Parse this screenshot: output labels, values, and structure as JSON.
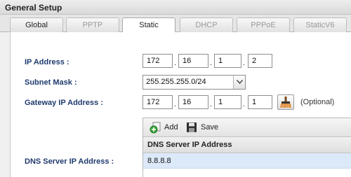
{
  "panel": {
    "title": "General Setup"
  },
  "tabs": [
    {
      "label": "Global",
      "state": "enabled"
    },
    {
      "label": "PPTP",
      "state": "disabled"
    },
    {
      "label": "Static",
      "state": "active"
    },
    {
      "label": "DHCP",
      "state": "disabled"
    },
    {
      "label": "PPPoE",
      "state": "disabled"
    },
    {
      "label": "StaticV6",
      "state": "disabled"
    }
  ],
  "form": {
    "ip_address": {
      "label": "IP Address :",
      "octets": [
        "172",
        "16",
        "1",
        "2"
      ]
    },
    "subnet_mask": {
      "label": "Subnet Mask :",
      "value": "255.255.255.0/24"
    },
    "gateway": {
      "label": "Gateway IP Address :",
      "octets": [
        "172",
        "16",
        "1",
        "1"
      ],
      "optional_text": "(Optional)"
    },
    "dns": {
      "label": "DNS Server IP Address :",
      "add_label": "Add",
      "save_label": "Save",
      "column_header": "DNS Server IP Address",
      "rows": [
        "8.8.8.8"
      ]
    }
  },
  "icons": {
    "add": "add-circle-icon",
    "save": "floppy-disk-icon",
    "selector": "broom-icon",
    "dropdown": "chevron-down-icon"
  },
  "colors": {
    "label_text": "#1f3b6e",
    "selected_row": "#dce9f9",
    "add_icon_green": "#3aa53a"
  }
}
